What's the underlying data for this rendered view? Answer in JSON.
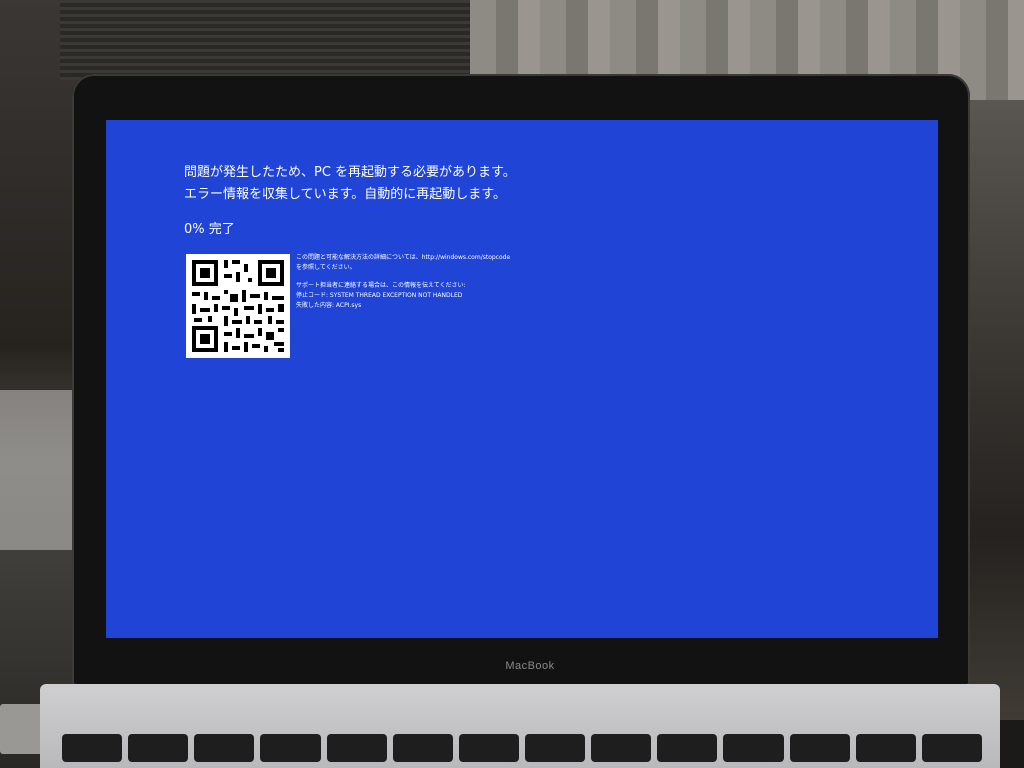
{
  "screen": {
    "headline_line1": "問題が発生したため、PC を再起動する必要があります。",
    "headline_line2": "エラー情報を収集しています。自動的に再起動します。",
    "progress_value": 0,
    "progress_text": "0% 完了",
    "info_line1": "この問題と可能な解決方法の詳細については、http://windows.com/stopcode",
    "info_line2": "を参照してください。",
    "support_line": "サポート担当者に連絡する場合は、この情報を伝えてください:",
    "stop_code_line": "停止コード: SYSTEM THREAD EXCEPTION NOT HANDLED",
    "failed_line": "失敗した内容: ACPI.sys",
    "background_color": "#1f44d6",
    "text_color": "#ffffff"
  },
  "device": {
    "brand_label": "MacBook"
  },
  "icons": {
    "qr_code": "qr-code-icon"
  }
}
